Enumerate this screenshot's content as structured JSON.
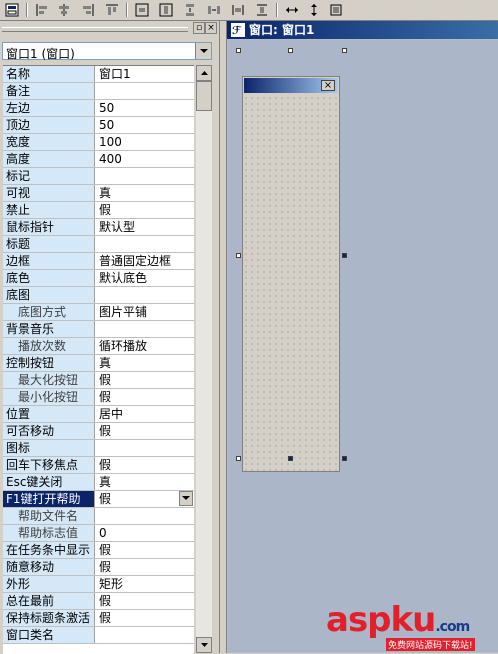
{
  "designer": {
    "window_title": "窗口: 窗口1",
    "form_close_glyph": "×"
  },
  "panel": {
    "close_glyph": "×",
    "pin_glyph": "▫",
    "combo_value": "窗口1 (窗口)"
  },
  "properties": [
    {
      "name": "名称",
      "value": "窗口1",
      "sub": false
    },
    {
      "name": "备注",
      "value": "",
      "sub": false
    },
    {
      "name": "左边",
      "value": "50",
      "sub": false
    },
    {
      "name": "顶边",
      "value": "50",
      "sub": false
    },
    {
      "name": "宽度",
      "value": "100",
      "sub": false
    },
    {
      "name": "高度",
      "value": "400",
      "sub": false
    },
    {
      "name": "标记",
      "value": "",
      "sub": false
    },
    {
      "name": "可视",
      "value": "真",
      "sub": false
    },
    {
      "name": "禁止",
      "value": "假",
      "sub": false
    },
    {
      "name": "鼠标指针",
      "value": "默认型",
      "sub": false
    },
    {
      "name": "标题",
      "value": "",
      "sub": false
    },
    {
      "name": "边框",
      "value": "普通固定边框",
      "sub": false
    },
    {
      "name": "底色",
      "value": "默认底色",
      "sub": false
    },
    {
      "name": "底图",
      "value": "",
      "sub": false
    },
    {
      "name": "底图方式",
      "value": "图片平铺",
      "sub": true
    },
    {
      "name": "背景音乐",
      "value": "",
      "sub": false
    },
    {
      "name": "播放次数",
      "value": "循环播放",
      "sub": true
    },
    {
      "name": "控制按钮",
      "value": "真",
      "sub": false
    },
    {
      "name": "最大化按钮",
      "value": "假",
      "sub": true
    },
    {
      "name": "最小化按钮",
      "value": "假",
      "sub": true
    },
    {
      "name": "位置",
      "value": "居中",
      "sub": false
    },
    {
      "name": "可否移动",
      "value": "假",
      "sub": false
    },
    {
      "name": "图标",
      "value": "",
      "sub": false
    },
    {
      "name": "回车下移焦点",
      "value": "假",
      "sub": false
    },
    {
      "name": "Esc键关闭",
      "value": "真",
      "sub": false
    },
    {
      "name": "F1键打开帮助",
      "value": "假",
      "sub": false,
      "selected": true
    },
    {
      "name": "帮助文件名",
      "value": "",
      "sub": true
    },
    {
      "name": "帮助标志值",
      "value": "0",
      "sub": true
    },
    {
      "name": "在任务条中显示",
      "value": "假",
      "sub": false
    },
    {
      "name": "随意移动",
      "value": "假",
      "sub": false
    },
    {
      "name": "外形",
      "value": "矩形",
      "sub": false
    },
    {
      "name": "总在最前",
      "value": "假",
      "sub": false
    },
    {
      "name": "保持标题条激活",
      "value": "假",
      "sub": false
    },
    {
      "name": "窗口类名",
      "value": "",
      "sub": false
    }
  ],
  "watermark": {
    "brand_pre": "asp",
    "brand_post": "ku",
    "brand_suffix": ".com",
    "tagline": "免费网站源码下载站!"
  },
  "colors": {
    "selected_row": "#0a246a",
    "name_cell": "#d4e8f8",
    "designer_bg": "#abb6c9",
    "watermark_red": "#e0202a"
  }
}
